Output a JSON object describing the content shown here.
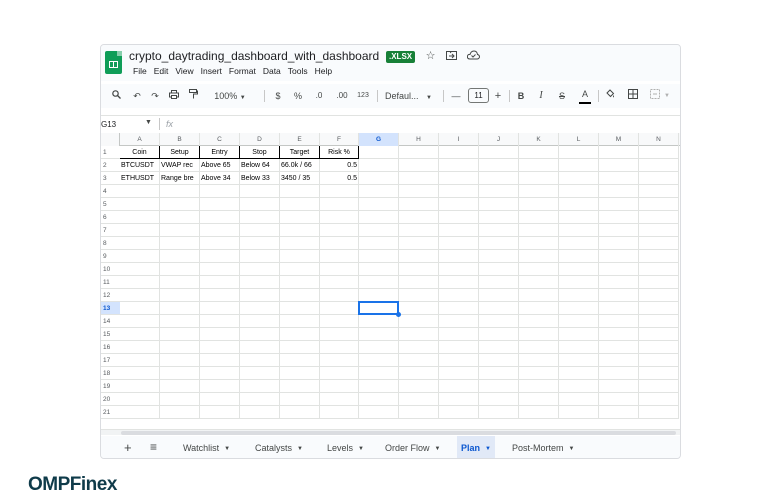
{
  "window": {
    "doc_title": "crypto_daytrading_dashboard_with_dashboard",
    "file_badge": ".XLSX",
    "title_icons": [
      "star-icon",
      "move-folder-icon",
      "cloud-status-icon"
    ]
  },
  "menu": [
    "File",
    "Edit",
    "View",
    "Insert",
    "Format",
    "Data",
    "Tools",
    "Help"
  ],
  "toolbar": {
    "zoom": "100%",
    "currency": "$",
    "percent": "%",
    "decrease_decimal": ".0",
    "increase_decimal": ".00",
    "number_format": "123",
    "font": "Defaul...",
    "font_size": "11",
    "bold": "B",
    "italic": "I",
    "strikethrough": "S",
    "text_color": "A"
  },
  "formula_bar": {
    "name_box": "G13",
    "fx": "fx"
  },
  "grid": {
    "columns": [
      "A",
      "B",
      "C",
      "D",
      "E",
      "F",
      "G",
      "H",
      "I",
      "J",
      "K",
      "L",
      "M",
      "N"
    ],
    "rows": [
      "1",
      "2",
      "3",
      "4",
      "5",
      "6",
      "7",
      "8",
      "9",
      "10",
      "11",
      "12",
      "13",
      "14",
      "15",
      "16",
      "17",
      "18",
      "19",
      "20",
      "21"
    ],
    "active_column": "G",
    "active_row": "13",
    "header_row": [
      "Coin",
      "Setup",
      "Entry",
      "Stop",
      "Target",
      "Risk %"
    ],
    "data_rows": [
      [
        "BTCUSDT",
        "VWAP rec",
        "Above 65",
        "Below 64",
        "66.0k / 66",
        "0.5"
      ],
      [
        "ETHUSDT",
        "Range bre",
        "Above 34",
        "Below 33",
        "3450 / 35",
        "0.5"
      ]
    ]
  },
  "sheet_tabs": [
    {
      "label": "Watchlist",
      "active": false
    },
    {
      "label": "Catalysts",
      "active": false
    },
    {
      "label": "Levels",
      "active": false
    },
    {
      "label": "Order Flow",
      "active": false
    },
    {
      "label": "Plan",
      "active": true
    },
    {
      "label": "Post-Mortem",
      "active": false
    }
  ],
  "brand": "OMPFinex",
  "colors": {
    "accent": "#1a73e8",
    "sheets_green": "#0f9d58",
    "badge_green": "#188038",
    "active_tab_bg": "#e1e9f7",
    "brand": "#0f3b4a"
  }
}
